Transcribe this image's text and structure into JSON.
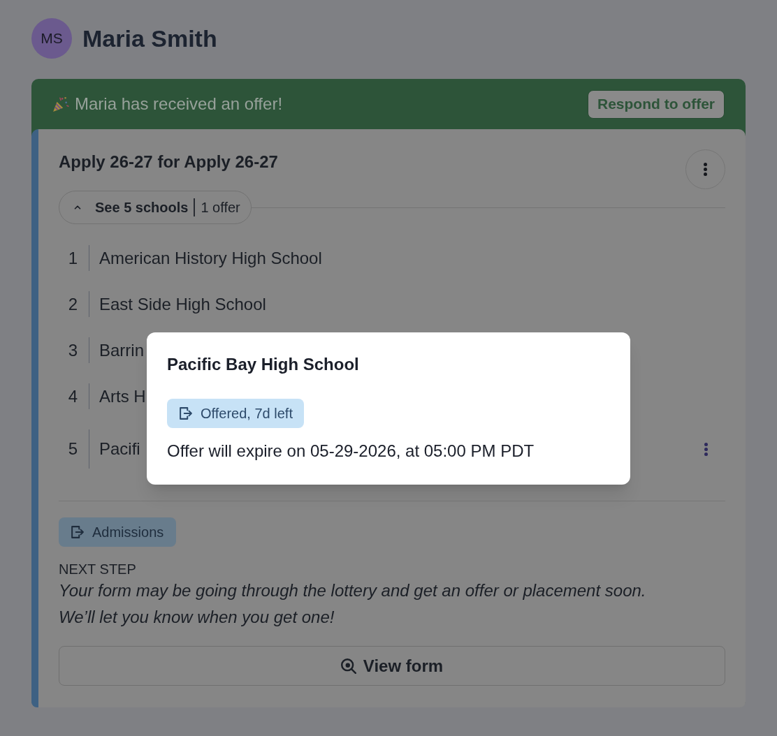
{
  "header": {
    "initials": "MS",
    "name": "Maria Smith"
  },
  "banner": {
    "message": "Maria has received an offer!",
    "button": "Respond to offer"
  },
  "application": {
    "title": "Apply 26-27 for Apply 26-27",
    "schools_toggle": {
      "schools": "See 5 schools",
      "offers": "1 offer",
      "expanded": true
    },
    "schools": [
      {
        "rank": "1",
        "name": "American History High School",
        "menu": false
      },
      {
        "rank": "2",
        "name": "East Side High School",
        "menu": false
      },
      {
        "rank": "3",
        "name": "Barrin",
        "menu": false
      },
      {
        "rank": "4",
        "name": "Arts H",
        "menu": false
      },
      {
        "rank": "5",
        "name": "Pacifi",
        "menu": true
      }
    ],
    "status_badge": "Admissions",
    "next_step": {
      "heading": "NEXT STEP",
      "text": "Your form may be going through the lottery and get an offer or placement soon. We’ll let you know when you get one!"
    },
    "view_button": "View form"
  },
  "popover": {
    "title": "Pacific Bay High School",
    "badge": "Offered, 7d left",
    "text": "Offer will expire on 05-29-2026, at 05:00 PM PDT"
  }
}
